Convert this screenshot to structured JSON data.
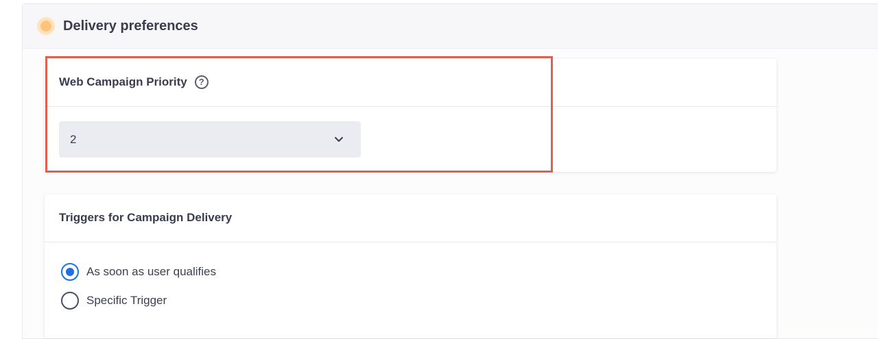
{
  "panel": {
    "title": "Delivery preferences"
  },
  "priority_card": {
    "title": "Web Campaign Priority",
    "help_symbol": "?",
    "select": {
      "selected_value": "2"
    }
  },
  "triggers_card": {
    "title": "Triggers for Campaign Delivery",
    "options": [
      {
        "label": "As soon as user qualifies",
        "checked": true
      },
      {
        "label": "Specific Trigger",
        "checked": false
      }
    ]
  },
  "colors": {
    "accent": "#1f6fe5",
    "highlight": "#e0604e",
    "status_dot": "#ffc479"
  }
}
